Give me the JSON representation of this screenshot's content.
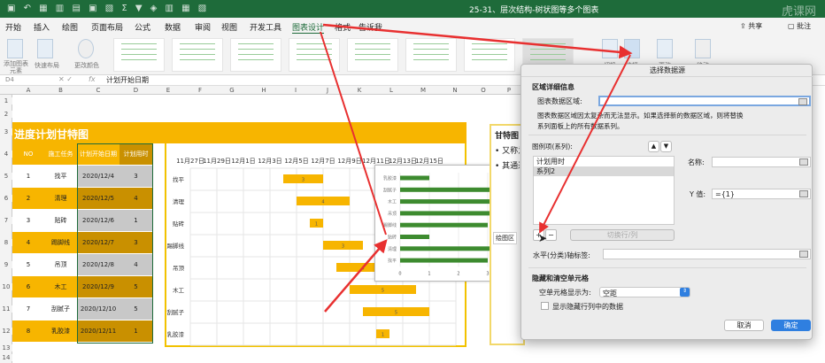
{
  "window": {
    "title": "25-31、层次结构-树状图等多个图表",
    "watermark": "虎课网"
  },
  "tabs": [
    {
      "label": "开始"
    },
    {
      "label": "插入"
    },
    {
      "label": "绘图"
    },
    {
      "label": "页面布局"
    },
    {
      "label": "公式"
    },
    {
      "label": "数据"
    },
    {
      "label": "审阅"
    },
    {
      "label": "视图"
    },
    {
      "label": "开发工具"
    },
    {
      "label": "图表设计",
      "active": true
    },
    {
      "label": "格式"
    },
    {
      "label": "告诉我"
    }
  ],
  "share": "共享",
  "comment": "批注",
  "ribbon": {
    "add_element": "添加图表元素",
    "quick_layout": "快速布局",
    "change_colors": "更改颜色",
    "switch": "切换",
    "select": "选择",
    "change": "更改",
    "move": "移动"
  },
  "formula": {
    "cell_ref": "D4",
    "fx": "fx",
    "value": "计划开始日期"
  },
  "columns": [
    "A",
    "B",
    "C",
    "D",
    "E",
    "F",
    "G",
    "H",
    "I",
    "J",
    "K",
    "L",
    "M",
    "N",
    "O",
    "P"
  ],
  "rows": [
    "1",
    "2",
    "3",
    "4",
    "5",
    "6",
    "7",
    "8",
    "9",
    "10",
    "11",
    "12",
    "13",
    "14"
  ],
  "sheet": {
    "title": "进度计划甘特图",
    "headers": [
      "NO",
      "施工任务",
      "计划开始日期",
      "计划用时"
    ],
    "data": [
      [
        "1",
        "找平",
        "2020/12/4",
        "3"
      ],
      [
        "2",
        "清理",
        "2020/12/5",
        "4"
      ],
      [
        "3",
        "贴砖",
        "2020/12/6",
        "1"
      ],
      [
        "4",
        "踢脚线",
        "2020/12/7",
        "3"
      ],
      [
        "5",
        "吊顶",
        "2020/12/8",
        "4"
      ],
      [
        "6",
        "木工",
        "2020/12/9",
        "5"
      ],
      [
        "7",
        "刮腻子",
        "2020/12/10",
        "5"
      ],
      [
        "8",
        "乳胶漆",
        "2020/12/11",
        "1"
      ]
    ],
    "colors": {
      "orange": "#f7b500",
      "dark_orange": "#c99000",
      "gray": "#c8c8c8"
    }
  },
  "textbox": {
    "title": "甘特图",
    "bullets": [
      "• 又称为",
      "• 其通过"
    ]
  },
  "chart_data": [
    {
      "type": "bar",
      "orientation": "horizontal",
      "subtype": "gantt",
      "categories": [
        "找平",
        "清理",
        "贴砖",
        "踢脚线",
        "吊顶",
        "木工",
        "刮腻子",
        "乳胶漆"
      ],
      "start": [
        "2020-12-04",
        "2020-12-05",
        "2020-12-06",
        "2020-12-07",
        "2020-12-08",
        "2020-12-09",
        "2020-12-10",
        "2020-12-11"
      ],
      "values": [
        3,
        4,
        1,
        3,
        4,
        5,
        5,
        1
      ],
      "xticks": [
        "11月27日",
        "11月29日",
        "12月1日",
        "12月3日",
        "12月5日",
        "12月7日",
        "12月9日",
        "12月11日",
        "12月13日",
        "12月15日"
      ],
      "xlim": [
        "2020-11-27",
        "2020-12-17"
      ],
      "color": "#f7b500",
      "grid": true,
      "data_labels": true
    },
    {
      "type": "bar",
      "orientation": "horizontal",
      "categories": [
        "乳胶漆",
        "刮腻子",
        "木工",
        "吊顶",
        "踢脚线",
        "贴砖",
        "清理",
        "找平"
      ],
      "values": [
        1,
        5,
        5,
        4,
        3,
        1,
        4,
        3
      ],
      "xticks": [
        "0",
        "1",
        "2",
        "3",
        "4"
      ],
      "xlim": [
        0,
        4
      ],
      "color": "#3d8b2f",
      "grid": true,
      "tooltip": "绘图区"
    }
  ],
  "dialog": {
    "title": "选择数据源",
    "section1": "区域详细信息",
    "range_label": "图表数据区域:",
    "range_value": "",
    "note1": "图表数据区域因太复杂而无法显示。如果选择新的数据区域，则将替换",
    "note2": "系列面板上的所有数据系列。",
    "legend_label": "图例项(系列):",
    "series": [
      {
        "label": "计划用时"
      },
      {
        "label": "系列2",
        "selected": true
      }
    ],
    "add": "+",
    "remove": "−",
    "switch": "切换行/列",
    "name_label": "名称:",
    "name_value": "",
    "y_label": "Y 值:",
    "y_value": "={1}",
    "axis_label": "水平(分类)轴标签:",
    "axis_value": "",
    "section2": "隐藏和清空单元格",
    "empty_label": "空单元格显示为:",
    "empty_value": "空距",
    "show_hidden": "显示隐藏行列中的数据",
    "show_hidden_checked": false,
    "cancel": "取消",
    "ok": "确定",
    "accent": "#2f7fe0"
  },
  "annotation_color": "#e83030"
}
